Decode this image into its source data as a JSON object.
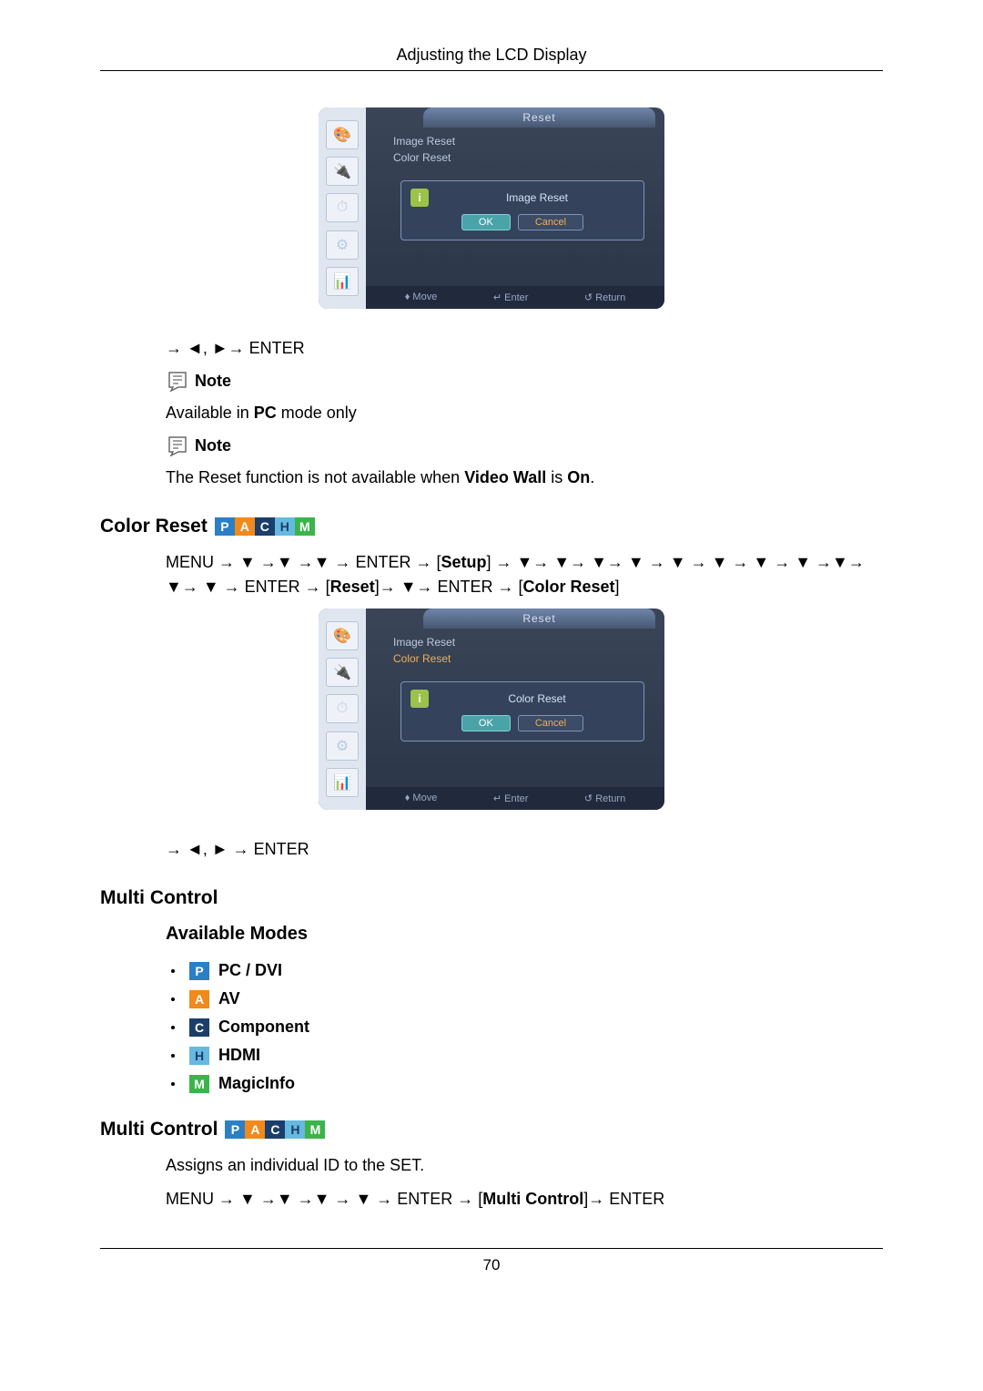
{
  "header": {
    "title": "Adjusting the LCD Display"
  },
  "osd1": {
    "tab": "Reset",
    "items": [
      "Image Reset",
      "Color Reset"
    ],
    "dialog_title": "Image Reset",
    "ok": "OK",
    "cancel": "Cancel",
    "footer": {
      "move": "Move",
      "enter": "Enter",
      "return": "Return"
    }
  },
  "line_enter1": "→ ◄, ►→ ENTER",
  "note_label": "Note",
  "note1_text_a": "Available in ",
  "note1_text_b": "PC",
  "note1_text_c": " mode only",
  "note2_text_a": "The Reset function is not available when ",
  "note2_text_b": "Video Wall",
  "note2_text_c": " is ",
  "note2_text_d": "On",
  "note2_text_e": ".",
  "section_color_reset": "Color Reset",
  "color_reset_path_a": "MENU → ▼ →▼ →▼ → ENTER → [",
  "color_reset_path_b": "Setup",
  "color_reset_path_c": "] → ▼→ ▼→ ▼→ ▼ → ▼ → ▼ → ▼ → ▼ →▼→ ▼→ ▼ → ENTER → [",
  "color_reset_path_d": "Reset",
  "color_reset_path_e": "]→ ▼→ ENTER → [",
  "color_reset_path_f": "Color Reset",
  "color_reset_path_g": "]",
  "osd2": {
    "tab": "Reset",
    "items": [
      "Image Reset",
      "Color Reset"
    ],
    "dialog_title": "Color Reset",
    "ok": "OK",
    "cancel": "Cancel",
    "footer": {
      "move": "Move",
      "enter": "Enter",
      "return": "Return"
    }
  },
  "line_enter2": "→ ◄, ► → ENTER",
  "section_multi_control": "Multi Control",
  "sub_available_modes": "Available Modes",
  "modes": [
    {
      "badge": "P",
      "cls": "mb-P",
      "label": "PC / DVI"
    },
    {
      "badge": "A",
      "cls": "mb-A",
      "label": "AV"
    },
    {
      "badge": "C",
      "cls": "mb-C",
      "label": "Component"
    },
    {
      "badge": "H",
      "cls": "mb-H",
      "label": "HDMI"
    },
    {
      "badge": "M",
      "cls": "mb-M",
      "label": "MagicInfo"
    }
  ],
  "section_multi_control2": "Multi Control",
  "multi_control_desc": "Assigns an individual ID to the SET.",
  "multi_control_path_a": "MENU → ▼ →▼ →▼ → ▼ → ENTER → [",
  "multi_control_path_b": "Multi Control",
  "multi_control_path_c": "]→ ENTER",
  "page_number": "70",
  "badges_all": [
    "P",
    "A",
    "C",
    "H",
    "M"
  ]
}
